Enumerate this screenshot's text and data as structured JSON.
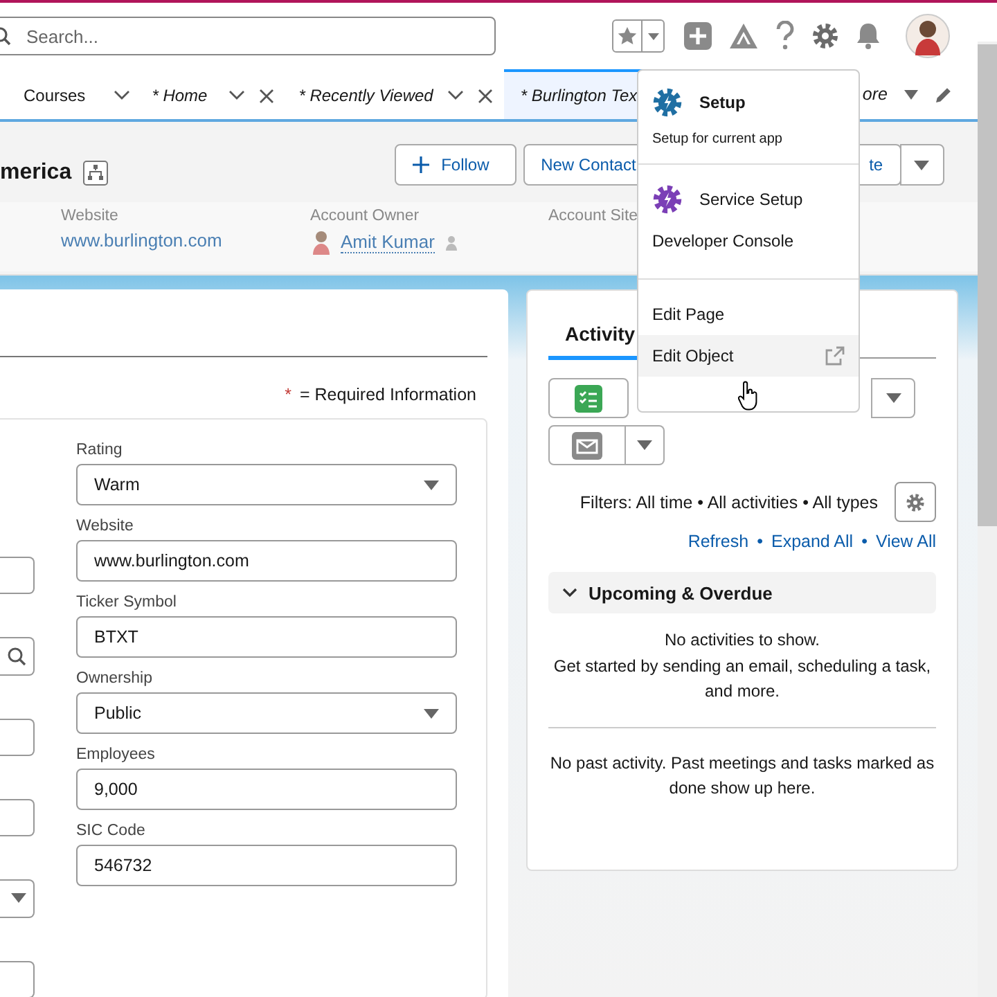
{
  "search": {
    "placeholder": "Search..."
  },
  "tabs": [
    {
      "label": "Courses",
      "unsaved": false,
      "closable": false,
      "selected": false
    },
    {
      "label": "* Home",
      "unsaved": true,
      "closable": true,
      "selected": false
    },
    {
      "label": "* Recently Viewed",
      "unsaved": true,
      "closable": true,
      "selected": false
    },
    {
      "label": "* Burlington Tex",
      "unsaved": true,
      "closable": false,
      "selected": true
    }
  ],
  "more_tab": {
    "label": "ore"
  },
  "record": {
    "title": "merica",
    "actions": [
      {
        "label": "Follow",
        "kind": "follow"
      },
      {
        "label": "New Contact",
        "kind": "plain"
      },
      {
        "label": "te",
        "kind": "plain"
      }
    ],
    "highlights": [
      {
        "label": "Website",
        "value": "www.burlington.com",
        "kind": "link"
      },
      {
        "label": "Account Owner",
        "value": "Amit Kumar",
        "kind": "user"
      },
      {
        "label": "Account Site",
        "kind": "empty"
      }
    ]
  },
  "form": {
    "required_mark": "*",
    "required_note": "= Required Information",
    "left_fields": [
      {
        "kind": "text"
      },
      {
        "kind": "lookup"
      },
      {
        "kind": "text"
      },
      {
        "kind": "text"
      },
      {
        "kind": "picklist"
      },
      {
        "kind": "text"
      }
    ],
    "right_fields": [
      {
        "label": "Rating",
        "value": "Warm",
        "kind": "picklist"
      },
      {
        "label": "Website",
        "value": "www.burlington.com",
        "kind": "text"
      },
      {
        "label": "Ticker Symbol",
        "value": "BTXT",
        "kind": "text"
      },
      {
        "label": "Ownership",
        "value": "Public",
        "kind": "picklist"
      },
      {
        "label": "Employees",
        "value": "9,000",
        "kind": "text"
      },
      {
        "label": "SIC Code",
        "value": "546732",
        "kind": "text"
      }
    ]
  },
  "activity": {
    "tab": "Activity",
    "filters": "Filters: All time • All activities • All types",
    "links": [
      "Refresh",
      "Expand All",
      "View All"
    ],
    "separator": "•",
    "section": {
      "title": "Upcoming & Overdue",
      "expanded": true,
      "empty_title": "No activities to show.",
      "empty_text": "Get started by sending an email, scheduling a task, and more."
    },
    "past": "No past activity. Past meetings and tasks marked as done show up here."
  },
  "menu": {
    "groups": [
      [
        {
          "label": "Setup",
          "kind": "header",
          "subtitle": "Setup for current app",
          "color": "#1f6fa3",
          "highlighted": false
        }
      ],
      [
        {
          "label": "Service Setup",
          "kind": "icon",
          "color": "#7b3fb6",
          "highlighted": false
        },
        {
          "label": "Developer Console",
          "kind": "plain",
          "highlighted": false
        }
      ],
      [
        {
          "label": "Edit Page",
          "kind": "plain",
          "highlighted": false
        },
        {
          "label": "Edit Object",
          "kind": "external",
          "highlighted": true
        }
      ]
    ]
  }
}
